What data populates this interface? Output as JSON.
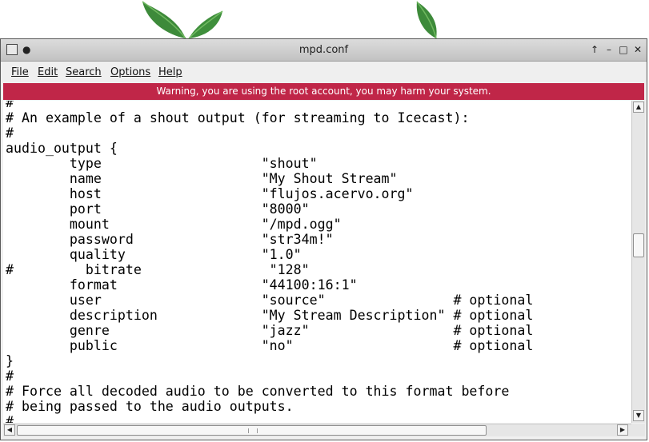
{
  "window": {
    "title": "mpd.conf",
    "warning": "Warning, you are using the root account, you may harm your system."
  },
  "menu": {
    "file": "File",
    "edit": "Edit",
    "search": "Search",
    "options": "Options",
    "help": "Help"
  },
  "titlebar_buttons": {
    "up": "↑",
    "minimize": "–",
    "maximize": "□",
    "close": "✕"
  },
  "editor": {
    "lines": [
      "#",
      "# An example of a shout output (for streaming to Icecast):",
      "#",
      "audio_output {",
      "        type                    \"shout\"",
      "        name                    \"My Shout Stream\"",
      "        host                    \"flujos.acervo.org\"",
      "        port                    \"8000\"",
      "        mount                   \"/mpd.ogg\"",
      "        password                \"str34m!\"",
      "        quality                 \"1.0\"",
      "#         bitrate                \"128\"",
      "        format                  \"44100:16:1\"",
      "        user                    \"source\"                # optional",
      "        description             \"My Stream Description\" # optional",
      "        genre                   \"jazz\"                  # optional",
      "        public                  \"no\"                    # optional",
      "}",
      "#",
      "# Force all decoded audio to be converted to this format before",
      "# being passed to the audio outputs.",
      "#"
    ]
  },
  "colors": {
    "warning_bg": "#c02648",
    "titlebar": "#d0d0d0"
  }
}
